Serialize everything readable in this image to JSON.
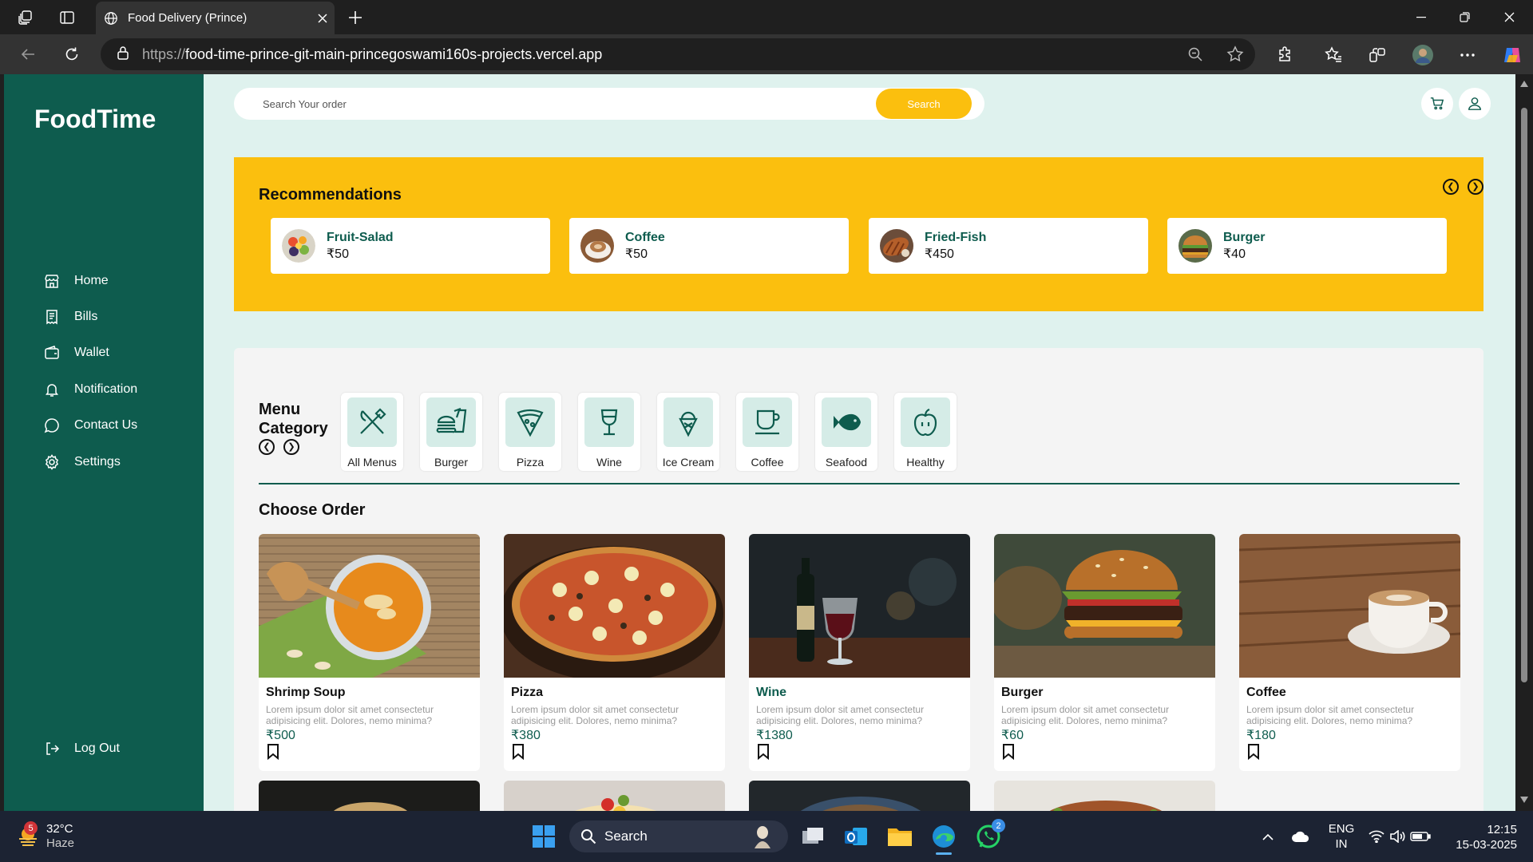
{
  "browser": {
    "tab_title": "Food Delivery (Prince)",
    "url_prefix": "https://",
    "url_main": "food-time-prince-git-main-princegoswami160s-projects.vercel.app"
  },
  "sidebar": {
    "logo": "FoodTime",
    "items": [
      {
        "label": "Home",
        "icon": "store-icon"
      },
      {
        "label": "Bills",
        "icon": "receipt-icon"
      },
      {
        "label": "Wallet",
        "icon": "wallet-icon"
      },
      {
        "label": "Notification",
        "icon": "bell-icon"
      },
      {
        "label": "Contact Us",
        "icon": "chat-icon"
      },
      {
        "label": "Settings",
        "icon": "gear-icon"
      }
    ],
    "logout": "Log Out"
  },
  "header": {
    "search_placeholder": "Search Your order",
    "search_button": "Search"
  },
  "recommendations": {
    "title": "Recommendations",
    "items": [
      {
        "name": "Fruit-Salad",
        "price": "₹50"
      },
      {
        "name": "Coffee",
        "price": "₹50"
      },
      {
        "name": "Fried-Fish",
        "price": "₹450"
      },
      {
        "name": "Burger",
        "price": "₹40"
      }
    ]
  },
  "menu": {
    "title_line1": "Menu",
    "title_line2": "Category",
    "categories": [
      {
        "label": "All Menus",
        "icon": "utensils-icon"
      },
      {
        "label": "Burger",
        "icon": "burger-icon"
      },
      {
        "label": "Pizza",
        "icon": "pizza-icon"
      },
      {
        "label": "Wine",
        "icon": "wine-glass-icon"
      },
      {
        "label": "Ice Cream",
        "icon": "ice-cream-icon"
      },
      {
        "label": "Coffee",
        "icon": "coffee-cup-icon"
      },
      {
        "label": "Seafood",
        "icon": "fish-icon"
      },
      {
        "label": "Healthy",
        "icon": "apple-icon"
      }
    ]
  },
  "orders": {
    "title": "Choose Order",
    "items": [
      {
        "name": "Shrimp Soup",
        "desc": "Lorem ipsum dolor sit amet consectetur adipisicing elit. Dolores, nemo minima?",
        "price": "₹500",
        "name_color": "#111111"
      },
      {
        "name": "Pizza",
        "desc": "Lorem ipsum dolor sit amet consectetur adipisicing elit. Dolores, nemo minima?",
        "price": "₹380",
        "name_color": "#111111"
      },
      {
        "name": "Wine",
        "desc": "Lorem ipsum dolor sit amet consectetur adipisicing elit. Dolores, nemo minima?",
        "price": "₹1380",
        "name_color": "#0e5c4e"
      },
      {
        "name": "Burger",
        "desc": "Lorem ipsum dolor sit amet consectetur adipisicing elit. Dolores, nemo minima?",
        "price": "₹60",
        "name_color": "#111111"
      },
      {
        "name": "Coffee",
        "desc": "Lorem ipsum dolor sit amet consectetur adipisicing elit. Dolores, nemo minima?",
        "price": "₹180",
        "name_color": "#111111"
      }
    ]
  },
  "taskbar": {
    "weather_temp": "32°C",
    "weather_desc": "Haze",
    "weather_badge": "5",
    "search_label": "Search",
    "whatsapp_badge": "2",
    "lang": "ENG",
    "region": "IN",
    "time": "12:15",
    "date": "15-03-2025"
  },
  "colors": {
    "brand_green": "#0e5c4e",
    "accent_yellow": "#fbbf0e",
    "page_bg": "#dff2ee"
  }
}
